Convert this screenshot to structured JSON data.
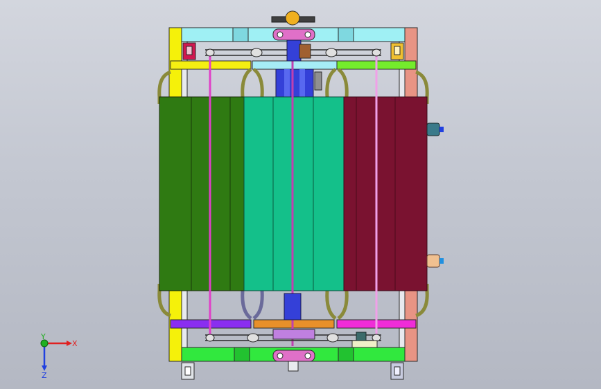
{
  "viewport": {
    "background_top": "#d3d6de",
    "background_bottom": "#b4b8c3"
  },
  "model": {
    "colors": {
      "frame": "#e8eaee",
      "frame_edge": "#2a2a2a",
      "left_post": "#f5f10a",
      "right_post": "#e89484",
      "top_bar": "#9ff0f4",
      "bottom_bar": "#31e83e",
      "rail_yellow": "#f5ef12",
      "rail_cyan": "#a6ecf6",
      "rail_green": "#74ec2c",
      "rail_purple": "#8a2ef0",
      "rail_orange": "#e8902a",
      "rail_magenta": "#f02cd8",
      "panel_green": "#2f7a12",
      "panel_teal": "#14c08a",
      "panel_maroon": "#7a1230",
      "shaft_blue": "#3440d8",
      "hub_pink": "#e070c8",
      "strap_olive": "#8a8a3a",
      "rod_pink": "#e040c8"
    }
  },
  "triad": {
    "x_label": "X",
    "y_label": "Y",
    "z_label": "Z",
    "x_color": "#e02020",
    "y_color": "#20b020",
    "z_color": "#2040e0"
  }
}
